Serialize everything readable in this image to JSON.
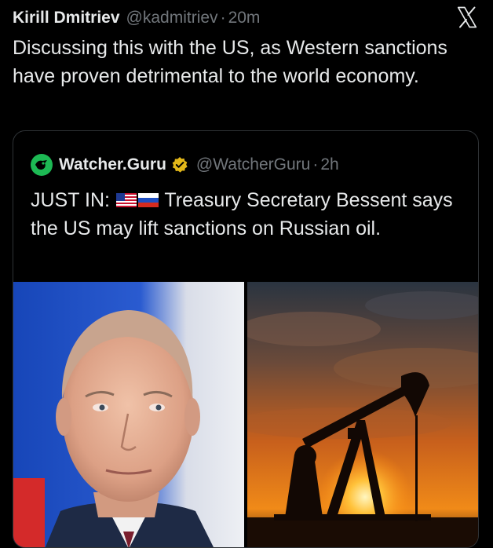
{
  "tweet": {
    "author_name": "Kirill Dmitriev",
    "author_handle": "@kadmitriev",
    "separator": "·",
    "time": "20m",
    "text": "Discussing this with the US, as Western sanctions have proven detrimental to the world economy."
  },
  "quoted": {
    "author_name": "Watcher.Guru",
    "author_handle": "@WatcherGuru",
    "separator": "·",
    "time": "2h",
    "text_prefix": "JUST IN:",
    "text_body": "Treasury Secretary Bessent says the US may lift sanctions on Russian oil.",
    "flags": [
      "us-flag-icon",
      "russia-flag-icon"
    ],
    "media": [
      {
        "name": "photo-man-portrait",
        "description_icon": "portrait-photo"
      },
      {
        "name": "photo-oil-pumpjack-sunset",
        "description_icon": "oil-pump-photo"
      }
    ]
  },
  "icons": {
    "platform_logo": "x-logo-icon",
    "verified_badge": "verified-badge-icon",
    "avatar": "watcher-guru-avatar-icon"
  },
  "colors": {
    "background": "#000000",
    "text_primary": "#e7e9ea",
    "text_secondary": "#71767b",
    "border": "#2f3336",
    "verified_gold": "#e2b719",
    "avatar_green": "#1db954"
  }
}
